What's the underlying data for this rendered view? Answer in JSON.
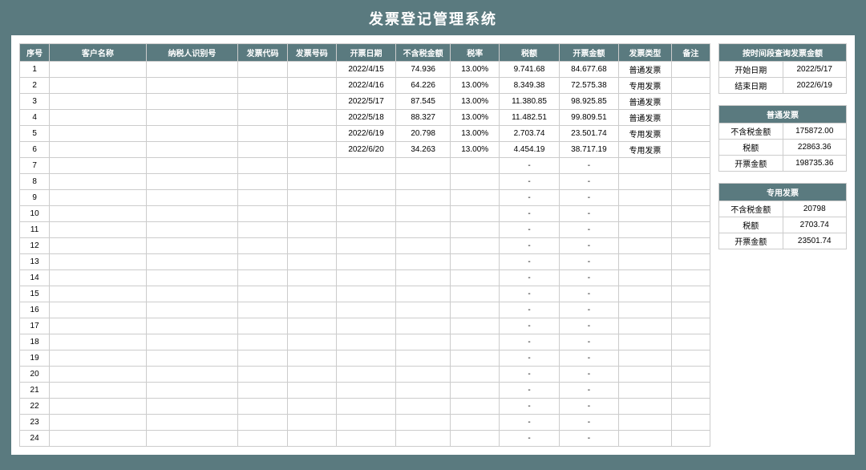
{
  "title": "发票登记管理系统",
  "columns": [
    "序号",
    "客户名称",
    "纳税人识别号",
    "发票代码",
    "发票号码",
    "开票日期",
    "不含税金额",
    "税率",
    "税额",
    "开票金额",
    "发票类型",
    "备注"
  ],
  "rows": [
    {
      "seq": "1",
      "cust": "",
      "taxid": "",
      "code": "",
      "num": "",
      "date": "2022/4/15",
      "amt": "74.936",
      "rate": "13.00%",
      "tax": "9.741.68",
      "total": "84.677.68",
      "type": "普通发票",
      "memo": ""
    },
    {
      "seq": "2",
      "cust": "",
      "taxid": "",
      "code": "",
      "num": "",
      "date": "2022/4/16",
      "amt": "64.226",
      "rate": "13.00%",
      "tax": "8.349.38",
      "total": "72.575.38",
      "type": "专用发票",
      "memo": ""
    },
    {
      "seq": "3",
      "cust": "",
      "taxid": "",
      "code": "",
      "num": "",
      "date": "2022/5/17",
      "amt": "87.545",
      "rate": "13.00%",
      "tax": "11.380.85",
      "total": "98.925.85",
      "type": "普通发票",
      "memo": ""
    },
    {
      "seq": "4",
      "cust": "",
      "taxid": "",
      "code": "",
      "num": "",
      "date": "2022/5/18",
      "amt": "88.327",
      "rate": "13.00%",
      "tax": "11.482.51",
      "total": "99.809.51",
      "type": "普通发票",
      "memo": ""
    },
    {
      "seq": "5",
      "cust": "",
      "taxid": "",
      "code": "",
      "num": "",
      "date": "2022/6/19",
      "amt": "20.798",
      "rate": "13.00%",
      "tax": "2.703.74",
      "total": "23.501.74",
      "type": "专用发票",
      "memo": ""
    },
    {
      "seq": "6",
      "cust": "",
      "taxid": "",
      "code": "",
      "num": "",
      "date": "2022/6/20",
      "amt": "34.263",
      "rate": "13.00%",
      "tax": "4.454.19",
      "total": "38.717.19",
      "type": "专用发票",
      "memo": ""
    },
    {
      "seq": "7",
      "cust": "",
      "taxid": "",
      "code": "",
      "num": "",
      "date": "",
      "amt": "",
      "rate": "",
      "tax": "-",
      "total": "-",
      "type": "",
      "memo": ""
    },
    {
      "seq": "8",
      "cust": "",
      "taxid": "",
      "code": "",
      "num": "",
      "date": "",
      "amt": "",
      "rate": "",
      "tax": "-",
      "total": "-",
      "type": "",
      "memo": ""
    },
    {
      "seq": "9",
      "cust": "",
      "taxid": "",
      "code": "",
      "num": "",
      "date": "",
      "amt": "",
      "rate": "",
      "tax": "-",
      "total": "-",
      "type": "",
      "memo": ""
    },
    {
      "seq": "10",
      "cust": "",
      "taxid": "",
      "code": "",
      "num": "",
      "date": "",
      "amt": "",
      "rate": "",
      "tax": "-",
      "total": "-",
      "type": "",
      "memo": ""
    },
    {
      "seq": "11",
      "cust": "",
      "taxid": "",
      "code": "",
      "num": "",
      "date": "",
      "amt": "",
      "rate": "",
      "tax": "-",
      "total": "-",
      "type": "",
      "memo": ""
    },
    {
      "seq": "12",
      "cust": "",
      "taxid": "",
      "code": "",
      "num": "",
      "date": "",
      "amt": "",
      "rate": "",
      "tax": "-",
      "total": "-",
      "type": "",
      "memo": ""
    },
    {
      "seq": "13",
      "cust": "",
      "taxid": "",
      "code": "",
      "num": "",
      "date": "",
      "amt": "",
      "rate": "",
      "tax": "-",
      "total": "-",
      "type": "",
      "memo": ""
    },
    {
      "seq": "14",
      "cust": "",
      "taxid": "",
      "code": "",
      "num": "",
      "date": "",
      "amt": "",
      "rate": "",
      "tax": "-",
      "total": "-",
      "type": "",
      "memo": ""
    },
    {
      "seq": "15",
      "cust": "",
      "taxid": "",
      "code": "",
      "num": "",
      "date": "",
      "amt": "",
      "rate": "",
      "tax": "-",
      "total": "-",
      "type": "",
      "memo": ""
    },
    {
      "seq": "16",
      "cust": "",
      "taxid": "",
      "code": "",
      "num": "",
      "date": "",
      "amt": "",
      "rate": "",
      "tax": "-",
      "total": "-",
      "type": "",
      "memo": ""
    },
    {
      "seq": "17",
      "cust": "",
      "taxid": "",
      "code": "",
      "num": "",
      "date": "",
      "amt": "",
      "rate": "",
      "tax": "-",
      "total": "-",
      "type": "",
      "memo": ""
    },
    {
      "seq": "18",
      "cust": "",
      "taxid": "",
      "code": "",
      "num": "",
      "date": "",
      "amt": "",
      "rate": "",
      "tax": "-",
      "total": "-",
      "type": "",
      "memo": ""
    },
    {
      "seq": "19",
      "cust": "",
      "taxid": "",
      "code": "",
      "num": "",
      "date": "",
      "amt": "",
      "rate": "",
      "tax": "-",
      "total": "-",
      "type": "",
      "memo": ""
    },
    {
      "seq": "20",
      "cust": "",
      "taxid": "",
      "code": "",
      "num": "",
      "date": "",
      "amt": "",
      "rate": "",
      "tax": "-",
      "total": "-",
      "type": "",
      "memo": ""
    },
    {
      "seq": "21",
      "cust": "",
      "taxid": "",
      "code": "",
      "num": "",
      "date": "",
      "amt": "",
      "rate": "",
      "tax": "-",
      "total": "-",
      "type": "",
      "memo": ""
    },
    {
      "seq": "22",
      "cust": "",
      "taxid": "",
      "code": "",
      "num": "",
      "date": "",
      "amt": "",
      "rate": "",
      "tax": "-",
      "total": "-",
      "type": "",
      "memo": ""
    },
    {
      "seq": "23",
      "cust": "",
      "taxid": "",
      "code": "",
      "num": "",
      "date": "",
      "amt": "",
      "rate": "",
      "tax": "-",
      "total": "-",
      "type": "",
      "memo": ""
    },
    {
      "seq": "24",
      "cust": "",
      "taxid": "",
      "code": "",
      "num": "",
      "date": "",
      "amt": "",
      "rate": "",
      "tax": "-",
      "total": "-",
      "type": "",
      "memo": ""
    }
  ],
  "filter": {
    "header": "按时间段查询发票金额",
    "start_label": "开始日期",
    "start_value": "2022/5/17",
    "end_label": "结束日期",
    "end_value": "2022/6/19"
  },
  "summary_common": {
    "header": "普通发票",
    "amt_label": "不含税金额",
    "amt_value": "175872.00",
    "tax_label": "税额",
    "tax_value": "22863.36",
    "total_label": "开票金额",
    "total_value": "198735.36"
  },
  "summary_special": {
    "header": "专用发票",
    "amt_label": "不含税金额",
    "amt_value": "20798",
    "tax_label": "税额",
    "tax_value": "2703.74",
    "total_label": "开票金额",
    "total_value": "23501.74"
  }
}
